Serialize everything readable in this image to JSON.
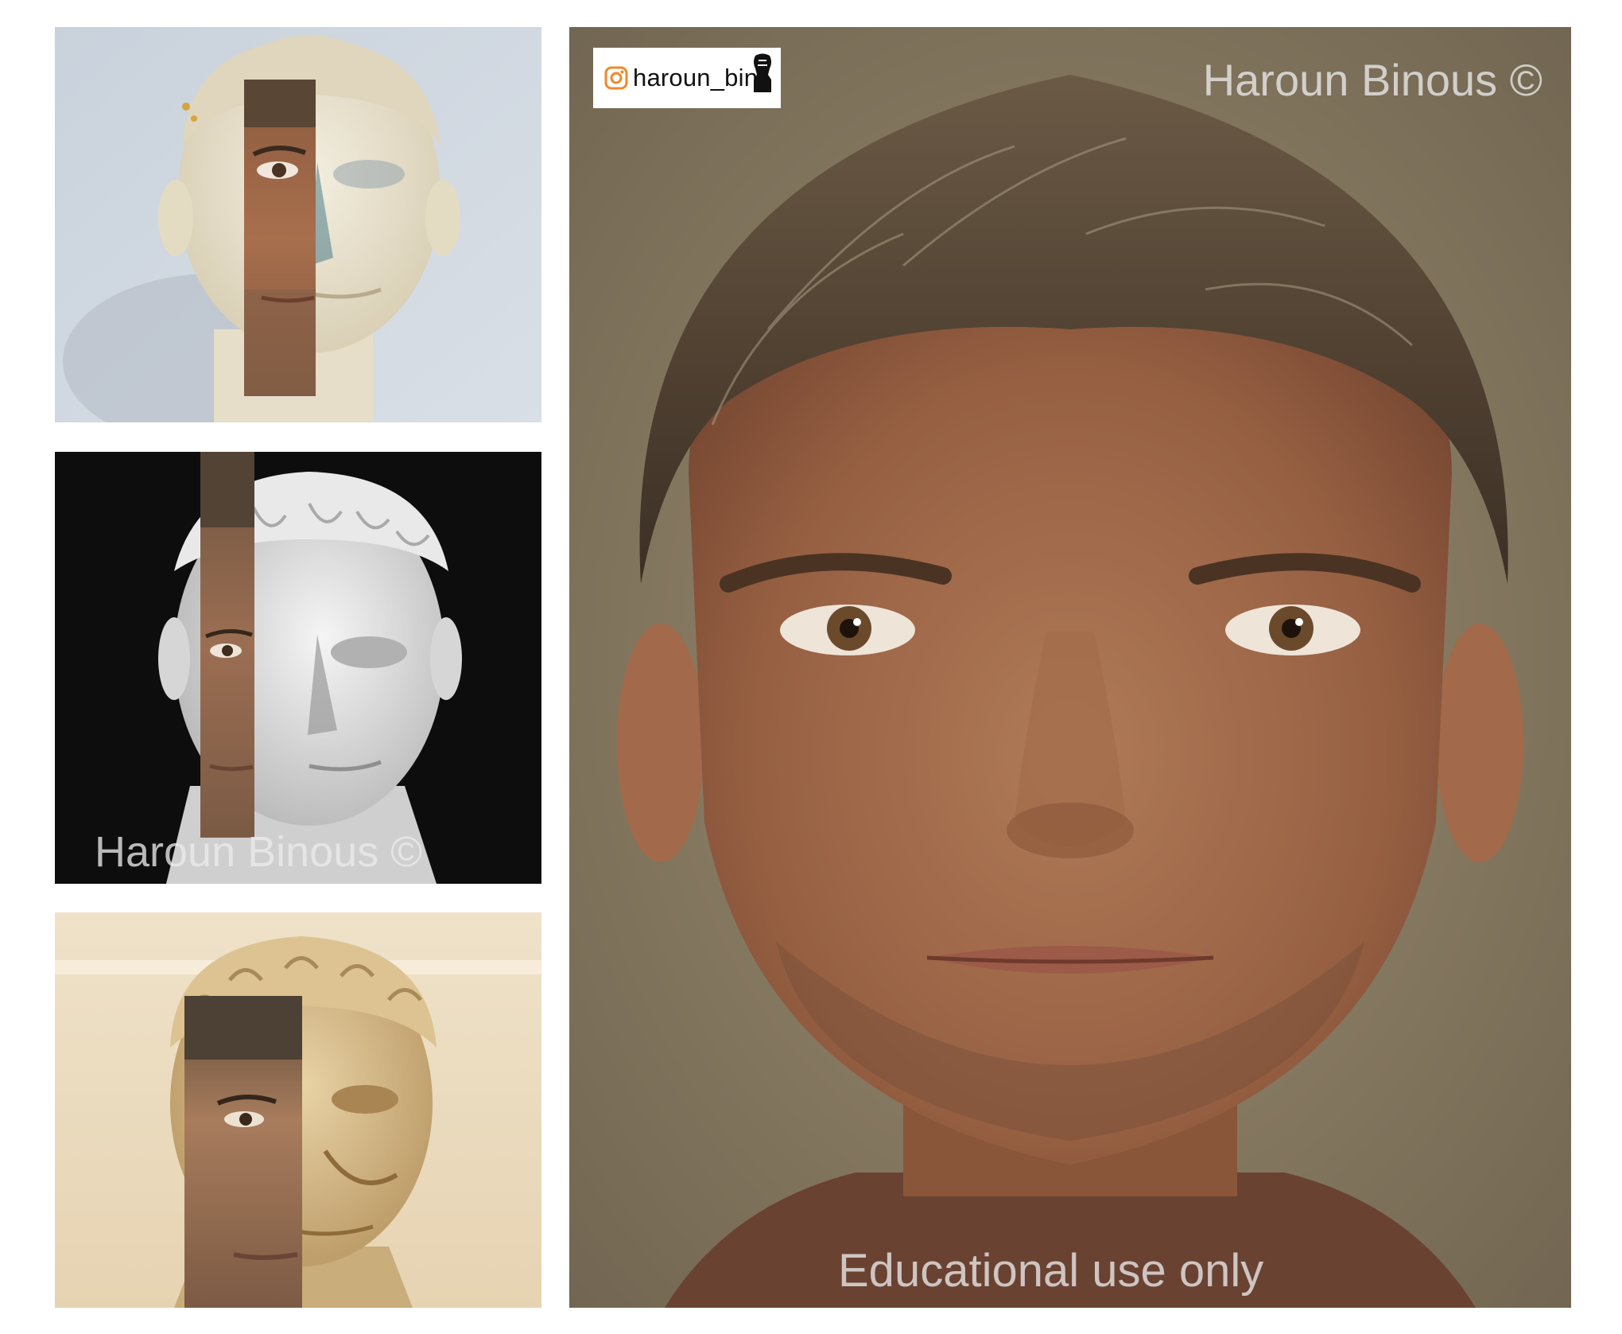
{
  "watermarks": {
    "author_mark": "Haroun Binous ©",
    "educational_notice": "Educational use only"
  },
  "badge": {
    "handle": "haroun_bin",
    "icon": "instagram-icon",
    "logo": "bust-logo-icon"
  },
  "colors": {
    "page_background": "#ffffff",
    "badge_orange": "#f0892a",
    "watermark_text": "#ebebeb"
  }
}
